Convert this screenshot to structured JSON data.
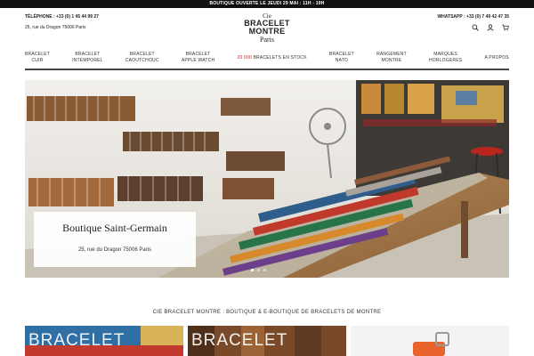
{
  "topbar": {
    "text": "BOUTIQUE OUVERTE LE JEUDI 29 MAI : 11H - 19H"
  },
  "header": {
    "phone": "TÉLÉPHONE : +33 (0) 1 45 44 99 27",
    "address": "25, rue du Dragon 75006 Paris",
    "whatsapp": "WHATSAPP : +33 (0) 7 49 42 47 35",
    "logo": {
      "cie": "Cie",
      "line1": "BRACELET",
      "line2": "MONTRE",
      "line3": "Paris"
    },
    "icons": [
      "search-icon",
      "user-icon",
      "cart-icon"
    ]
  },
  "nav": {
    "items": [
      {
        "line1": "BRACELET",
        "line2": "CUIR"
      },
      {
        "line1": "BRACELET",
        "line2": "INTEMPOREL"
      },
      {
        "line1": "BRACELET",
        "line2": "CAOUTCHOUC"
      },
      {
        "line1": "BRACELET",
        "line2": "APPLE WATCH"
      },
      {
        "number": "20 000",
        "rest": "BRACELETS EN STOCK"
      },
      {
        "line1": "BRACELET",
        "line2": "NATO"
      },
      {
        "line1": "RANGEMENT",
        "line2": "MONTRE"
      },
      {
        "line1": "MARQUES",
        "line2": "HORLOGERES"
      },
      {
        "line1": "A PROPOS",
        "line2": ""
      }
    ],
    "highlight_color": "#c41a1a"
  },
  "hero": {
    "title": "Boutique Saint-Germain",
    "address": "25, rue du Dragon 75006 Paris"
  },
  "section": {
    "title": "CIE BRACELET MONTRE : BOUTIQUE & E-BOUTIQUE DE BRACELETS DE MONTRE"
  },
  "tiles": [
    {
      "label": "BRACELET",
      "color": "#2f6fa3"
    },
    {
      "label": "BRACELET",
      "color": "#7a4a28"
    },
    {
      "label": "",
      "color": "#f3f3f3"
    }
  ]
}
